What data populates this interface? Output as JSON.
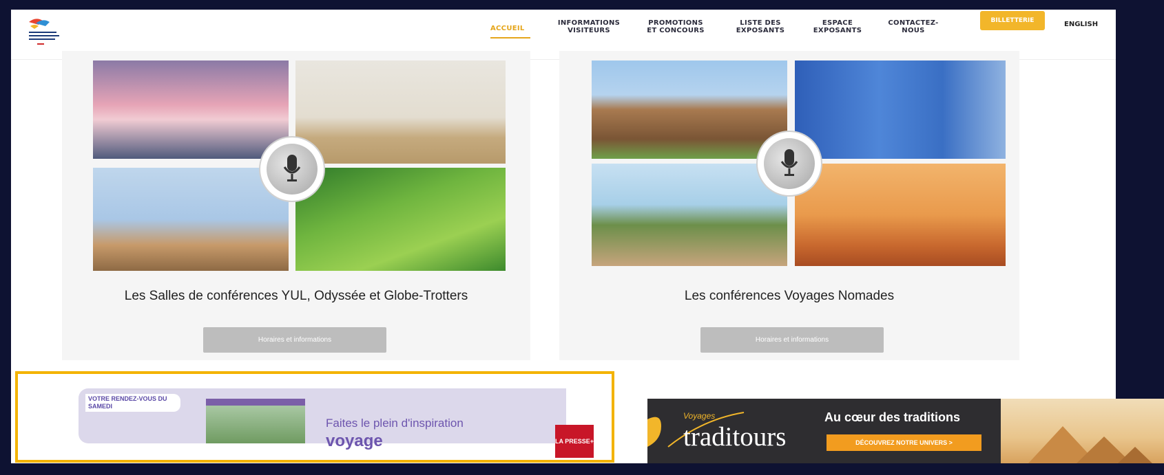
{
  "nav": {
    "items": [
      {
        "label": "ACCUEIL"
      },
      {
        "label": "INFORMATIONS VISITEURS"
      },
      {
        "label": "PROMOTIONS ET CONCOURS"
      },
      {
        "label": "LISTE DES EXPOSANTS"
      },
      {
        "label": "ESPACE EXPOSANTS"
      },
      {
        "label": "CONTACTEZ-NOUS"
      }
    ],
    "cta_label": "BILLETTERIE",
    "lang_label": "ENGLISH"
  },
  "cards": [
    {
      "title": "Les Salles de conférences YUL, Odyssée et Globe-Trotters",
      "button_label": "Horaires et informations"
    },
    {
      "title": "Les conférences Voyages Nomades",
      "button_label": "Horaires et informations"
    }
  ],
  "banner_left": {
    "tag": "VOTRE RENDEZ-VOUS DU SAMEDI",
    "line1": "Faites le plein d'inspiration",
    "line2": "voyage",
    "brand": "LA PRESSE+"
  },
  "banner_right": {
    "pre": "Voyages",
    "brand": "traditours",
    "tagline": "Au cœur des traditions",
    "cta": "DÉCOUVREZ NOTRE UNIVERS >"
  },
  "colors": {
    "accent": "#e5a51a",
    "cta": "#f2b62a",
    "frame": "#f3b300",
    "purple": "#6d55ae"
  }
}
